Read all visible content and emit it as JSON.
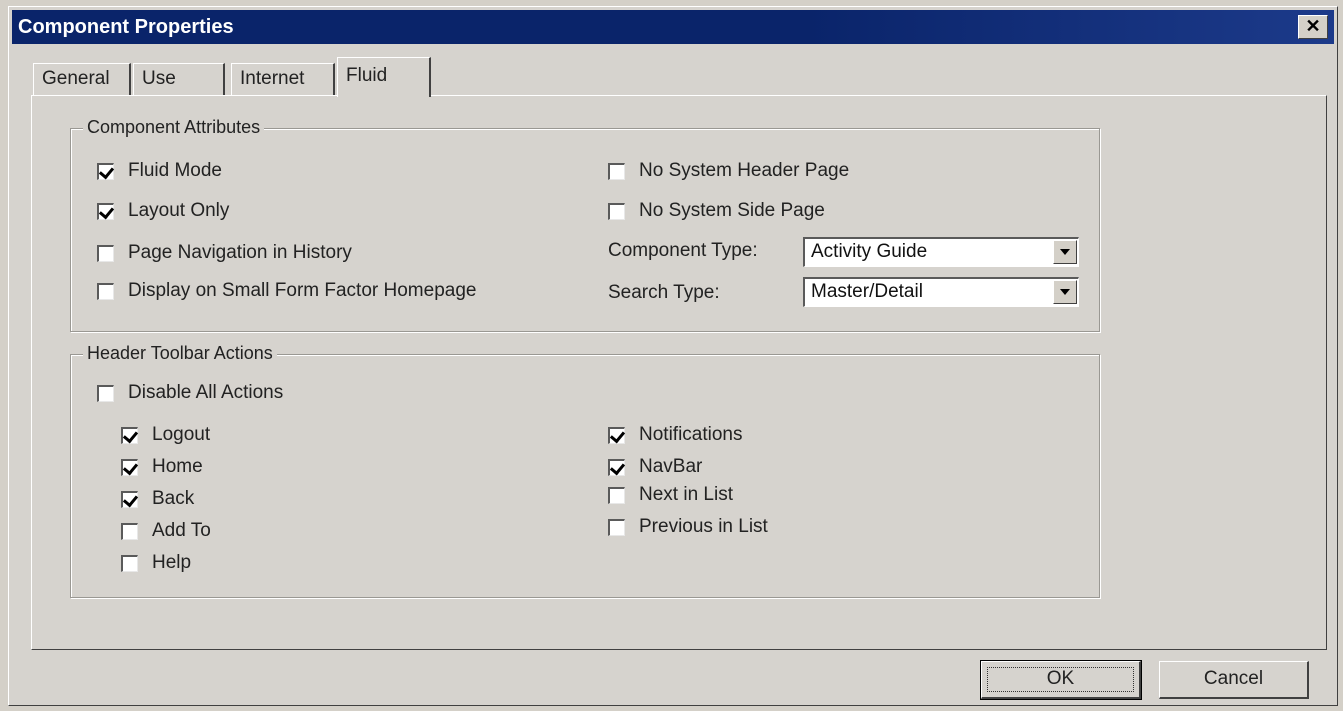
{
  "window": {
    "title": "Component Properties",
    "close_glyph": "✕"
  },
  "tabs": [
    {
      "label": "General",
      "active": false
    },
    {
      "label": "Use",
      "active": false
    },
    {
      "label": "Internet",
      "active": false
    },
    {
      "label": "Fluid",
      "active": true
    }
  ],
  "component_attributes": {
    "title": "Component Attributes",
    "left": [
      {
        "label": "Fluid Mode",
        "checked": true
      },
      {
        "label": "Layout Only",
        "checked": true
      },
      {
        "label": "Page Navigation in History",
        "checked": false
      },
      {
        "label": "Display on Small Form Factor Homepage",
        "checked": false
      }
    ],
    "right": [
      {
        "label": "No System Header Page",
        "checked": false
      },
      {
        "label": "No System Side Page",
        "checked": false
      }
    ],
    "component_type": {
      "label": "Component Type:",
      "value": "Activity Guide"
    },
    "search_type": {
      "label": "Search Type:",
      "value": "Master/Detail"
    }
  },
  "header_toolbar": {
    "title": "Header Toolbar Actions",
    "disable_all": {
      "label": "Disable All Actions",
      "checked": false
    },
    "left": [
      {
        "label": "Logout",
        "checked": true
      },
      {
        "label": "Home",
        "checked": true
      },
      {
        "label": "Back",
        "checked": true
      },
      {
        "label": "Add To",
        "checked": false
      },
      {
        "label": "Help",
        "checked": false
      }
    ],
    "right": [
      {
        "label": "Notifications",
        "checked": true
      },
      {
        "label": "NavBar",
        "checked": true
      },
      {
        "label": "Next in List",
        "checked": false
      },
      {
        "label": "Previous in List",
        "checked": false
      }
    ]
  },
  "buttons": {
    "ok": "OK",
    "cancel": "Cancel"
  }
}
